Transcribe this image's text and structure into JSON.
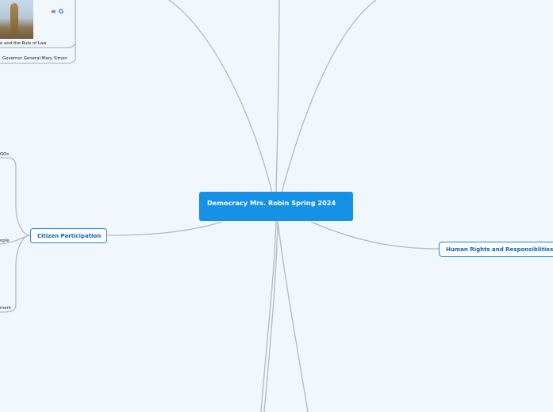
{
  "central": {
    "title": "Democracy Mrs. Robin Spring 2024"
  },
  "topics": {
    "citizen": "Citizen Participation",
    "rights": "Human Rights and Responsiblities"
  },
  "top_left": {
    "rule_of_law": "e and the Rule of Law",
    "governor": "Governor General Mary Simon",
    "menu_glyph": "≡",
    "google_glyph": "G"
  },
  "citizen_children": {
    "a": "GOs",
    "b": "ople",
    "c": "ment"
  },
  "colors": {
    "background": "#f2f6fd",
    "central": "#1691e6",
    "topic_border": "#1f89de",
    "topic_text": "#0e63b8",
    "line": "#b4b8bf"
  }
}
